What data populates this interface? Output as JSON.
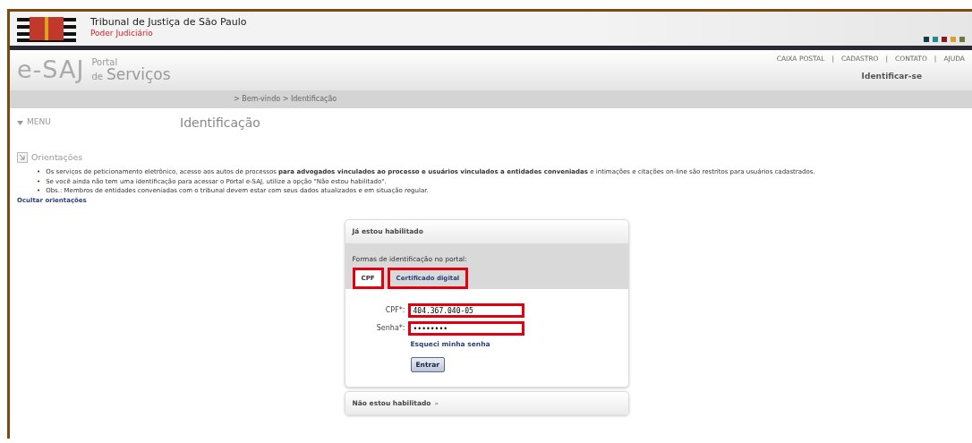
{
  "header": {
    "title": "Tribunal de Justiça de São Paulo",
    "subtitle": "Poder Judiciário",
    "color_squares": [
      {
        "color": "#0e3d45"
      },
      {
        "color": "#1f8c8c"
      },
      {
        "color": "#8a1a1a"
      },
      {
        "color": "#d9a030"
      },
      {
        "color": "#6b7a3a"
      }
    ]
  },
  "portal": {
    "logo_main": "e-SAJ",
    "logo_top": "Portal",
    "logo_de": "de",
    "logo_bottom": "Serviços",
    "top_links": [
      "CAIXA POSTAL",
      "CADASTRO",
      "CONTATO",
      "AJUDA"
    ],
    "separator": "|",
    "identify_link": "Identificar-se"
  },
  "breadcrumb": "> Bem-vindo > Identificação",
  "menu": {
    "label": "MENU",
    "expanded": false
  },
  "page_title": "Identificação",
  "orientations": {
    "title": "Orientações",
    "bullet": "•",
    "items": [
      "Os serviços de peticionamento eletrônico, acesso aos autos de processos **para advogados vinculados ao processo e usuários vinculados a entidades conveniadas** e intimações e citações on-line são restritos para usuários cadastrados.",
      "Se você ainda não tem uma identificação para acessar o Portal e-SAJ, utilize a opção \"Não estou habilitado\".",
      "Obs.: Membros de entidades conveniadas com o tribunal devem estar com seus dados atualizados e em situação regular."
    ],
    "hide_link": "Ocultar orientações"
  },
  "login": {
    "title": "Já estou habilitado",
    "forms_label": "Formas de identificação no portal:",
    "tabs": [
      {
        "label": "CPF",
        "selected": true,
        "highlighted": true
      },
      {
        "label": "Certificado digital",
        "selected": false,
        "highlighted": true
      }
    ],
    "fields": [
      {
        "label": "CPF*:",
        "value": "404.367.040-05",
        "highlighted": true
      },
      {
        "label": "Senha*:",
        "value": "••••••••",
        "highlighted": true
      }
    ],
    "forgot_link": "Esqueci minha senha",
    "submit": "Entrar"
  },
  "not_enabled": {
    "title": "Não estou habilitado",
    "arrow": "»"
  }
}
